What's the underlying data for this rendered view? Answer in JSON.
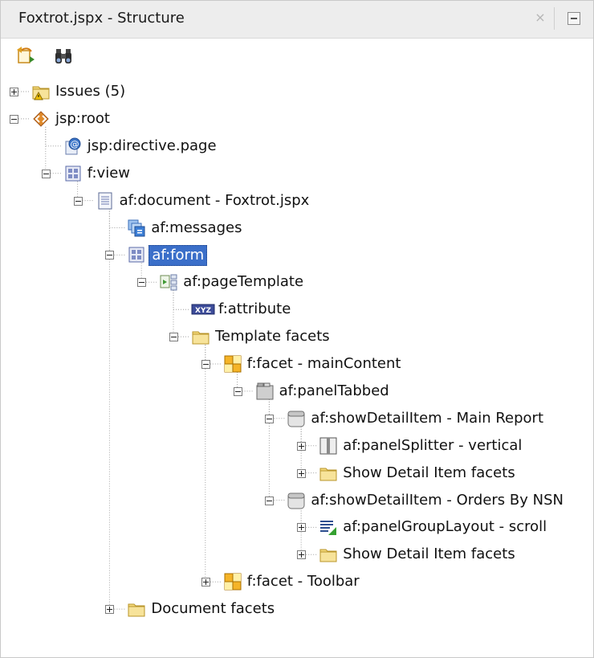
{
  "window": {
    "title": "Foxtrot.jspx - Structure",
    "close_glyph": "×"
  },
  "toolbar": {
    "buttons": [
      {
        "name": "freeze-view-icon"
      },
      {
        "name": "find-binoculars-icon"
      }
    ]
  },
  "tree": [
    {
      "label": "Issues (5)",
      "icon": "folder-warning-icon",
      "toggle": "plus",
      "depth": 0
    },
    {
      "label": "jsp:root",
      "icon": "jsp-root-icon",
      "toggle": "minus",
      "depth": 0
    },
    {
      "label": "jsp:directive.page",
      "icon": "jsp-directive-icon",
      "toggle": null,
      "depth": 1
    },
    {
      "label": "f:view",
      "icon": "component-grid-icon",
      "toggle": "minus",
      "depth": 1
    },
    {
      "label": "af:document - Foxtrot.jspx",
      "icon": "document-icon",
      "toggle": "minus",
      "depth": 2
    },
    {
      "label": "af:messages",
      "icon": "messages-icon",
      "toggle": null,
      "depth": 3
    },
    {
      "label": "af:form",
      "icon": "component-grid-icon",
      "toggle": "minus",
      "depth": 3,
      "selected": true
    },
    {
      "label": "af:pageTemplate",
      "icon": "page-template-icon",
      "toggle": "minus",
      "depth": 4
    },
    {
      "label": "f:attribute",
      "icon": "attribute-xyz-icon",
      "toggle": null,
      "depth": 5
    },
    {
      "label": "Template facets",
      "icon": "folder-icon",
      "toggle": "minus",
      "depth": 5
    },
    {
      "label": "f:facet - mainContent",
      "icon": "facet-icon",
      "toggle": "minus",
      "depth": 6
    },
    {
      "label": "af:panelTabbed",
      "icon": "panel-tabbed-icon",
      "toggle": "minus",
      "depth": 7
    },
    {
      "label": "af:showDetailItem - Main Report",
      "icon": "show-detail-item-icon",
      "toggle": "minus",
      "depth": 8
    },
    {
      "label": "af:panelSplitter - vertical",
      "icon": "panel-splitter-icon",
      "toggle": "plus",
      "depth": 9
    },
    {
      "label": "Show Detail Item facets",
      "icon": "folder-icon",
      "toggle": "plus",
      "depth": 9
    },
    {
      "label": "af:showDetailItem - Orders By NSN",
      "icon": "show-detail-item-icon",
      "toggle": "minus",
      "depth": 8
    },
    {
      "label": "af:panelGroupLayout - scroll",
      "icon": "panel-group-layout-icon",
      "toggle": "plus",
      "depth": 9
    },
    {
      "label": "Show Detail Item facets",
      "icon": "folder-icon",
      "toggle": "plus",
      "depth": 9
    },
    {
      "label": "f:facet - Toolbar",
      "icon": "facet-icon",
      "toggle": "plus",
      "depth": 6
    },
    {
      "label": "Document facets",
      "icon": "folder-icon",
      "toggle": "plus",
      "depth": 3
    }
  ]
}
